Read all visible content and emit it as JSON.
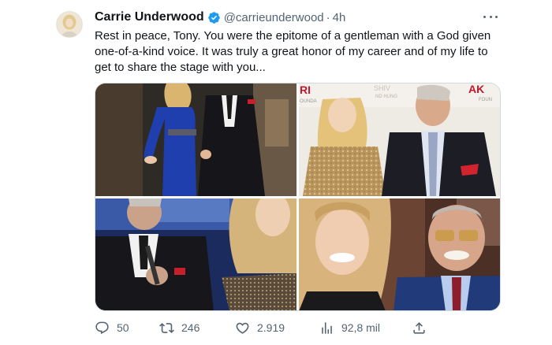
{
  "tweet": {
    "author_name": "Carrie Underwood",
    "handle": "@carrieunderwood",
    "separator": "·",
    "time": "4h",
    "text": "Rest in peace, Tony. You were the epitome of a gentleman with a God given one-of-a-kind voice.  It was truly a great honor of my career and of my life to get to share the stage with you...",
    "verified_color": "#1d9bf0"
  },
  "photo_signage": {
    "sign_ri": "RI",
    "sign_shiv": "SHIV",
    "sign_nd_hung": "ND HUNG",
    "sign_ak": "AK",
    "sign_found": "FOUN",
    "sign_ounda": "OUNDA"
  },
  "actions": {
    "reply_count": "50",
    "retweet_count": "246",
    "like_count": "2.919",
    "views_count": "92,8 mil"
  },
  "icons": {
    "reply": "reply-icon",
    "retweet": "retweet-icon",
    "like": "heart-icon",
    "views": "views-icon",
    "share": "share-icon",
    "more": "more-icon",
    "verified": "verified-badge-icon"
  }
}
